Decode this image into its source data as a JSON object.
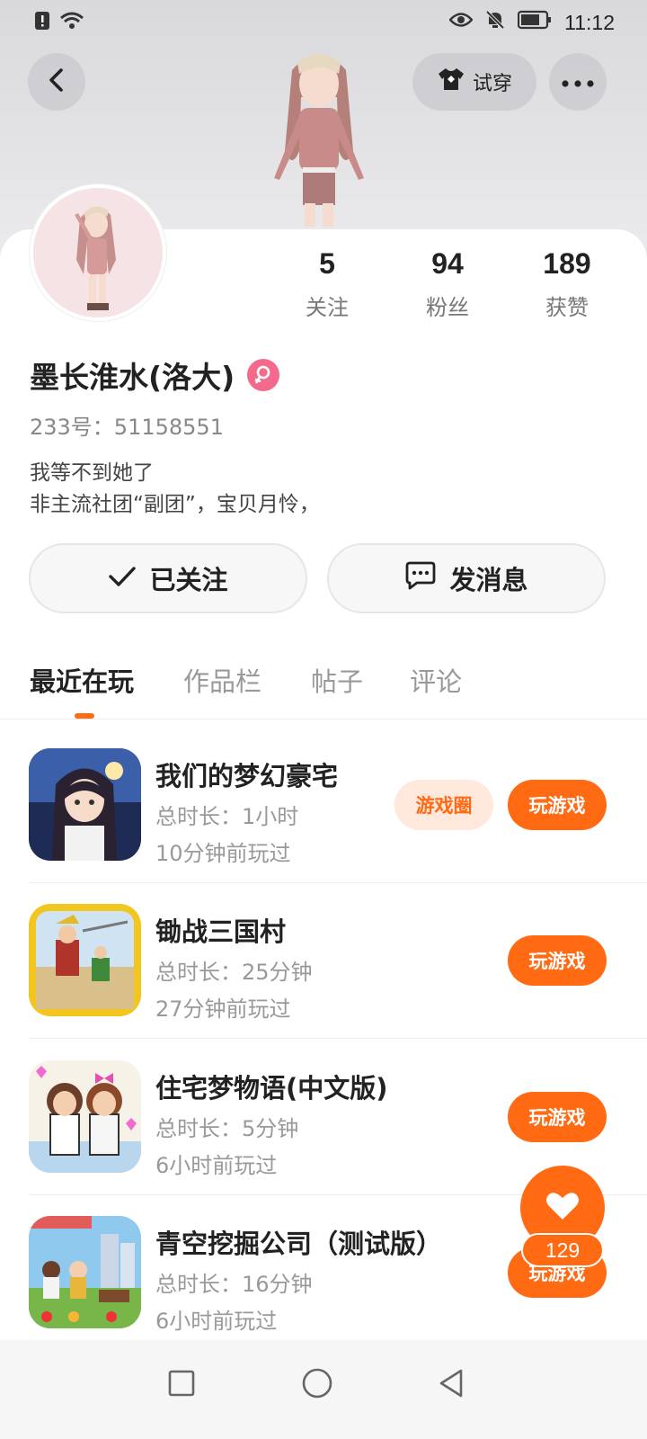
{
  "status_bar": {
    "time": "11:12",
    "icons": [
      "alert-icon",
      "wifi-icon",
      "eye-icon",
      "mute-bell-icon",
      "battery-icon"
    ]
  },
  "header": {
    "back_icon": "chevron-left-icon",
    "try_on_label": "试穿",
    "try_on_icon": "shirt-icon",
    "more_icon": "more-dots-icon"
  },
  "profile": {
    "name": "墨长淮水(洛大)",
    "gender_icon": "female-icon",
    "uid": "233号：51158551",
    "bio_line1": "我等不到她了",
    "bio_line2": "非主流社团“副团”，宝贝月怜，",
    "stats": [
      {
        "value": "5",
        "label": "关注"
      },
      {
        "value": "94",
        "label": "粉丝"
      },
      {
        "value": "189",
        "label": "获赞"
      }
    ]
  },
  "actions": {
    "follow_label": "已关注",
    "message_label": "发消息"
  },
  "tabs": [
    "最近在玩",
    "作品栏",
    "帖子",
    "评论"
  ],
  "games": [
    {
      "title": "我们的梦幻豪宅",
      "duration": "总时长：1小时",
      "last_played": "10分钟前玩过",
      "circle_label": "游戏圈",
      "play_label": "玩游戏"
    },
    {
      "title": "锄战三国村",
      "duration": "总时长：25分钟",
      "last_played": "27分钟前玩过",
      "play_label": "玩游戏"
    },
    {
      "title": "住宅梦物语(中文版)",
      "duration": "总时长：5分钟",
      "last_played": "6小时前玩过",
      "play_label": "玩游戏"
    },
    {
      "title": "青空挖掘公司（测试版）",
      "duration": "总时长：16分钟",
      "last_played": "6小时前玩过",
      "play_label": "玩游戏"
    }
  ],
  "like_fab": {
    "count": "129"
  },
  "colors": {
    "accent": "#ff6a13",
    "accent_light": "#ffe8dc",
    "female": "#f36a8d"
  }
}
